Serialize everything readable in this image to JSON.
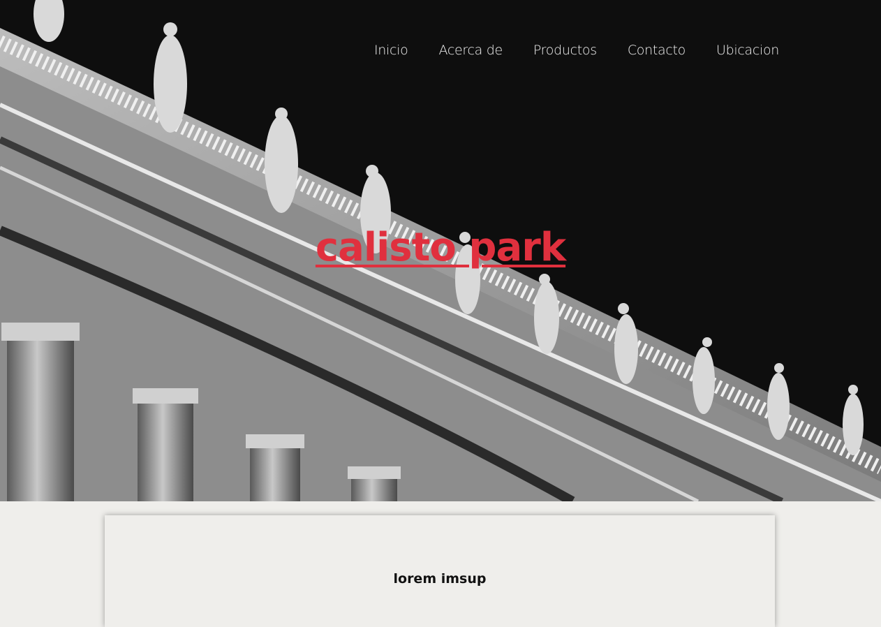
{
  "nav": {
    "items": [
      "Inicio",
      "Acerca de",
      "Productos",
      "Contacto",
      "Ubicacion"
    ]
  },
  "hero": {
    "title": "calisto park",
    "image": "colonnade-statues-photo"
  },
  "card": {
    "heading": "lorem imsup"
  },
  "colors": {
    "accent": "#e0303e",
    "page_bg": "#efeeeb",
    "hero_bg": "#0e0e0e",
    "nav_text": "#f2f2f2"
  }
}
